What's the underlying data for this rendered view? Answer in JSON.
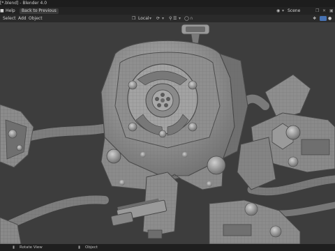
{
  "window": {
    "title": "[*.blend] - Blender 4.0"
  },
  "topbar": {
    "menu_help": "Help",
    "back_button": "Back to Previous",
    "scene_label": "Scene"
  },
  "header": {
    "select": "Select",
    "add": "Add",
    "object": "Object",
    "orientation": "Local"
  },
  "status": {
    "rotate_view": "Rotate View",
    "object": "Object"
  },
  "colors": {
    "viewport_bg": "#3d3d3d",
    "mesh": "#9a9a9a",
    "titlebar": "#1d1d1d"
  }
}
